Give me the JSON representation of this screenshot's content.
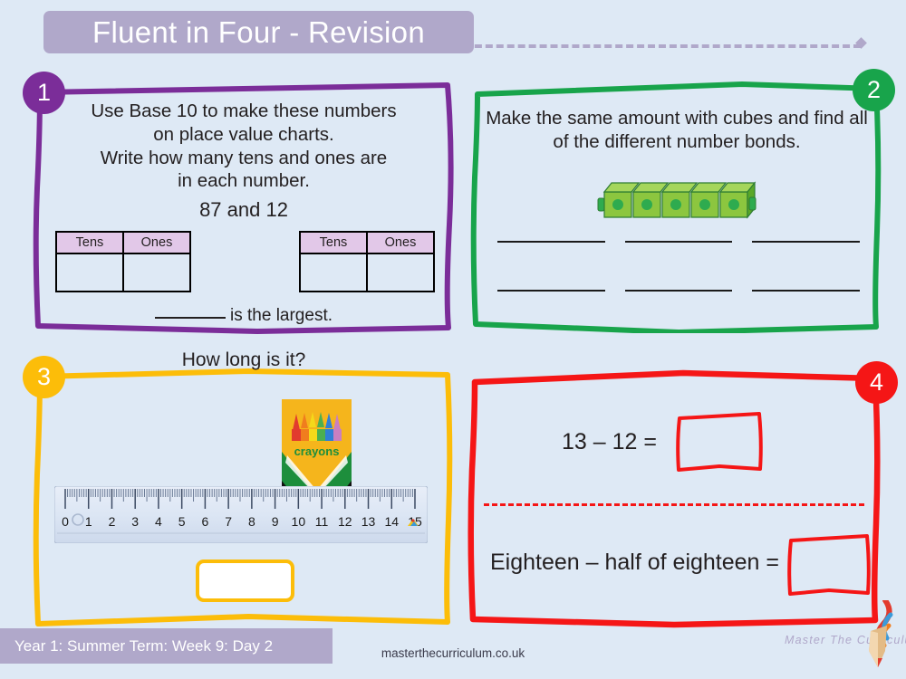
{
  "header": {
    "title": "Fluent in Four - Revision",
    "bar_color": "#b0a8ca"
  },
  "panels": [
    {
      "number": "1",
      "accent": "#7b2d99",
      "prompt": "Use Base 10 to make these numbers on place value charts. Write how many tens and ones are in each number.",
      "prompt_lines": [
        "Use Base 10 to make these numbers",
        "on place value charts.",
        "Write how many tens and ones are",
        "in each number."
      ],
      "numbers_line": "87  and 12",
      "tables": [
        {
          "headers": [
            "Tens",
            "Ones"
          ],
          "cells": [
            "",
            ""
          ]
        },
        {
          "headers": [
            "Tens",
            "Ones"
          ],
          "cells": [
            "",
            ""
          ]
        }
      ],
      "closing_text": "is the largest."
    },
    {
      "number": "2",
      "accent": "#18a44b",
      "prompt_lines": [
        "Make the same amount with cubes and find all",
        "of the different number bonds."
      ],
      "cube_count": 5,
      "cube_color": "#8cc63f",
      "answer_line_count": 6
    },
    {
      "number": "3",
      "accent": "#fcbd09",
      "title": "How long is it?",
      "object_label": "crayons",
      "ruler": {
        "unit_labels": [
          "0",
          "1",
          "2",
          "3",
          "4",
          "5",
          "6",
          "7",
          "8",
          "9",
          "10",
          "11",
          "12",
          "13",
          "14",
          "15"
        ],
        "min": 0,
        "max": 15
      },
      "answer_box_value": ""
    },
    {
      "number": "4",
      "accent": "#f51616",
      "equations": [
        {
          "text": "13 – 12 =",
          "answer": ""
        },
        {
          "text": "Eighteen – half of eighteen =",
          "answer": ""
        }
      ]
    }
  ],
  "footer": {
    "lesson_label": "Year 1: Summer Term: Week 9: Day 2",
    "website": "masterthecurriculum.co.uk",
    "brand": "Master The Curriculum"
  }
}
